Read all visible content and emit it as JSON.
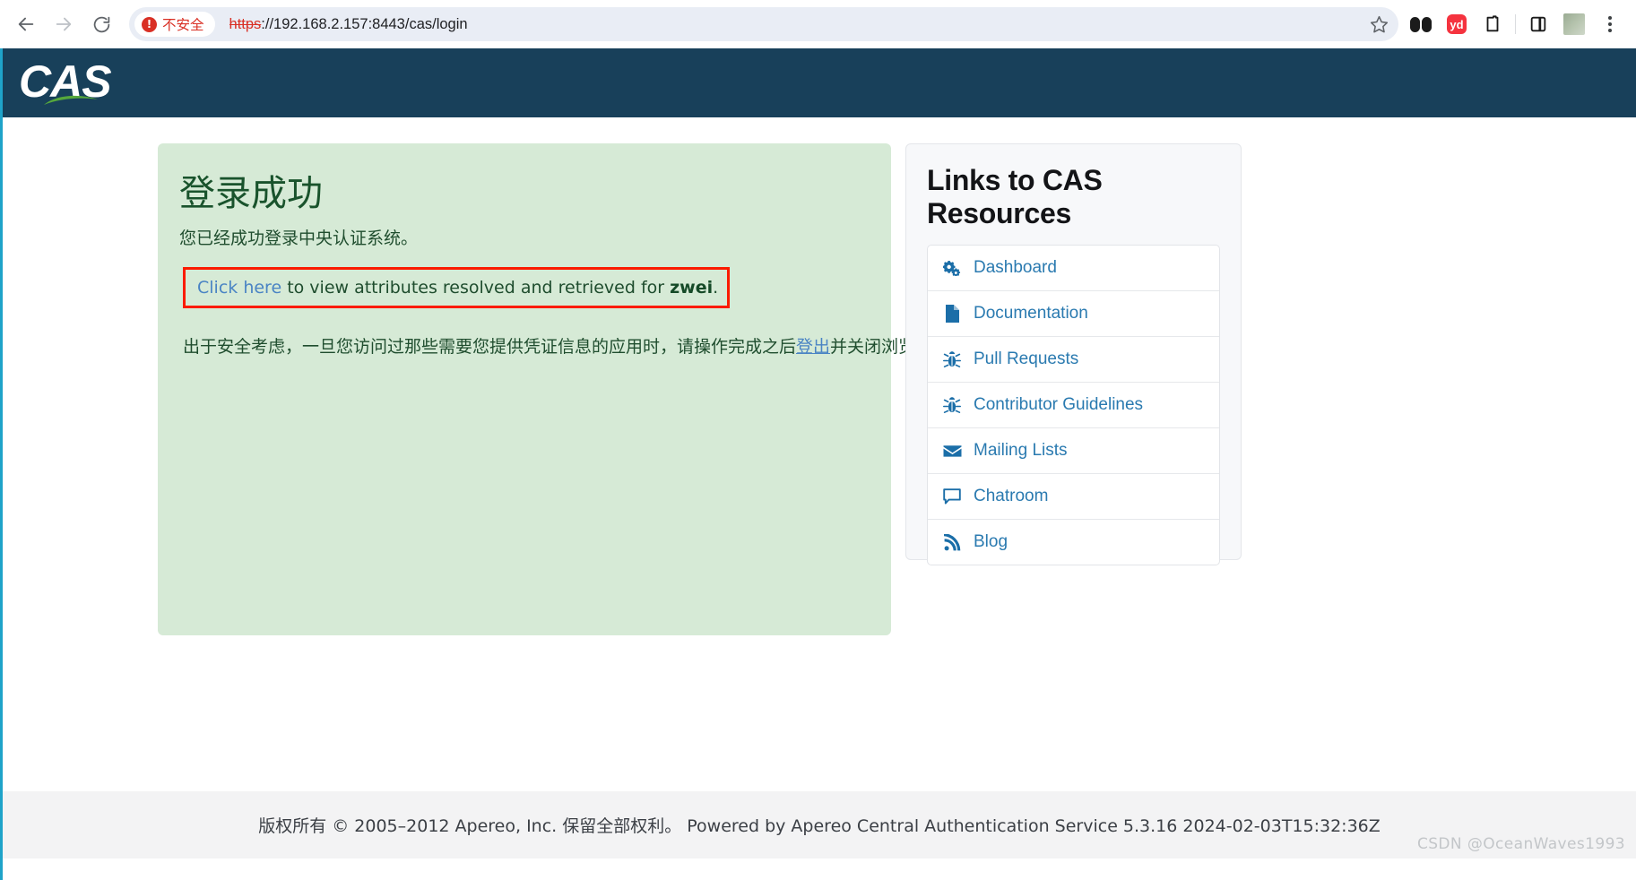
{
  "browser": {
    "back_label": "back-navigation",
    "forward_label": "forward-navigation",
    "reload_label": "reload-page",
    "security_badge": "不安全",
    "url_scheme": "https",
    "url_rest": "://192.168.2.157:8443/cas/login",
    "bookmark_label": "bookmark-star",
    "extensions": [
      {
        "name": "dual-dot-extension",
        "label": ""
      },
      {
        "name": "youdao-dict-extension",
        "label": "yd"
      },
      {
        "name": "clipboard-extension",
        "label": ""
      }
    ],
    "side_panel_label": "side-panel",
    "profile_label": "profile-avatar",
    "menu_label": "chrome-menu"
  },
  "header": {
    "logo_text": "CAS"
  },
  "success": {
    "title": "登录成功",
    "subtitle": "您已经成功登录中央认证系统。",
    "attributes_link": "Click here",
    "attributes_text_before": " ",
    "attributes_text_middle": "to view attributes resolved and retrieved for ",
    "attributes_user": "zwei",
    "attributes_text_after": ".",
    "security_note_part1": "出于安全考虑，一旦您访问过那些需要您提供凭证信息的应用时，请操作完成之后",
    "security_note_link": "登出",
    "security_note_part2": "并关闭浏览器。"
  },
  "resources": {
    "title": "Links to CAS Resources",
    "items": [
      {
        "label": "Dashboard",
        "icon": "cogs-icon"
      },
      {
        "label": "Documentation",
        "icon": "file-icon"
      },
      {
        "label": "Pull Requests",
        "icon": "bug-icon"
      },
      {
        "label": "Contributor Guidelines",
        "icon": "bug-icon"
      },
      {
        "label": "Mailing Lists",
        "icon": "envelope-icon"
      },
      {
        "label": "Chatroom",
        "icon": "comment-icon"
      },
      {
        "label": "Blog",
        "icon": "rss-icon"
      }
    ]
  },
  "footer": {
    "text": "版权所有 © 2005–2012 Apereo, Inc. 保留全部权利。 Powered by Apereo Central Authentication Service 5.3.16 2024-02-03T15:32:36Z"
  },
  "watermark": {
    "text": "CSDN @OceanWaves1993"
  },
  "colors": {
    "header_bg": "#18405a",
    "success_bg": "#d6ead6",
    "success_text": "#1f4d2e",
    "highlight_border": "#fb1b00",
    "link_blue": "#2a7ab0",
    "insecure_red": "#d93025"
  }
}
